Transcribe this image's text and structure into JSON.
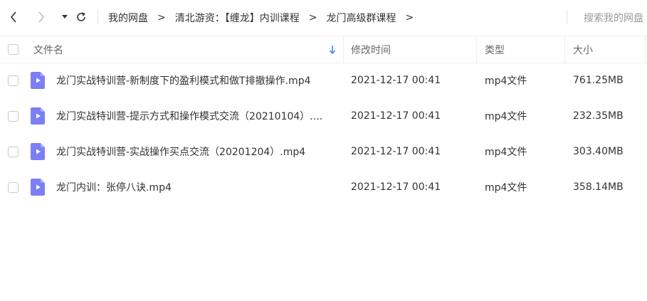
{
  "nav": {
    "back_icon": "chevron-left-icon",
    "forward_icon": "chevron-right-icon",
    "history_icon": "caret-down-icon",
    "refresh_icon": "refresh-icon"
  },
  "breadcrumb": [
    {
      "label": "我的网盘"
    },
    {
      "label": "清北游资：【缠龙】内训课程"
    },
    {
      "label": "龙门高级群课程"
    }
  ],
  "breadcrumb_separator": ">",
  "search": {
    "placeholder": "搜索我的网盘"
  },
  "table": {
    "columns": {
      "name": "文件名",
      "time": "修改时间",
      "type": "类型",
      "size": "大小"
    },
    "sort_icon": "arrow-down-icon",
    "rows": [
      {
        "name": "龙门实战特训营-新制度下的盈利模式和做T排撤操作.mp4",
        "time": "2021-12-17 00:41",
        "type": "mp4文件",
        "size": "761.25MB"
      },
      {
        "name": "龙门实战特训营-提示方式和操作模式交流（20210104）....",
        "time": "2021-12-17 00:41",
        "type": "mp4文件",
        "size": "232.35MB"
      },
      {
        "name": "龙门实战特训营-实战操作买点交流（20201204）.mp4",
        "time": "2021-12-17 00:41",
        "type": "mp4文件",
        "size": "303.40MB"
      },
      {
        "name": "龙门内训：张停八诀.mp4",
        "time": "2021-12-17 00:41",
        "type": "mp4文件",
        "size": "358.14MB"
      }
    ]
  },
  "colors": {
    "video_icon": "#7b7ff5",
    "accent": "#3b8cff"
  }
}
